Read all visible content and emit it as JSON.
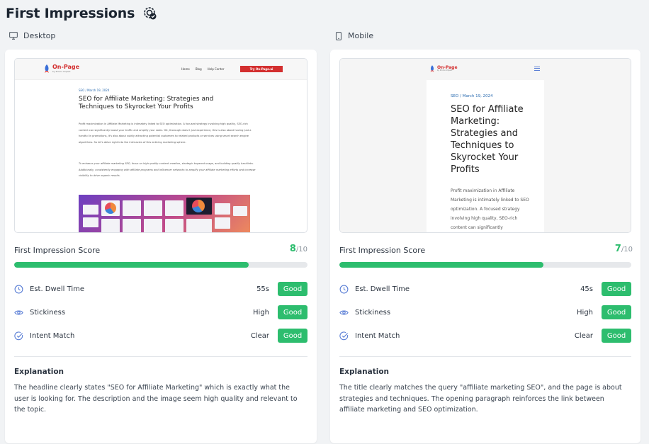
{
  "header": {
    "title": "First Impressions",
    "icon": "target-check-icon"
  },
  "columns": {
    "desktop": {
      "label": "Desktop",
      "preview": {
        "logo_main": "On-Page",
        "logo_sub": "by Promo Impact",
        "menu": [
          "Home",
          "Blog",
          "Help Center"
        ],
        "cta": "Try On-Page.ai",
        "meta": "SEO / March 19, 2024",
        "headline": "SEO for Affiliate Marketing: Strategies and Techniques to Skyrocket Your Profits",
        "para1": "Profit maximization in Affiliate Marketing is intimately linked to SEO optimization. A focused strategy involving high quality, SEO-rich content can significantly boost your traffic and amplify your sales. Yet, thorough does it just experience, this is also about having just a handful in promotions, it's also about subtly attracting potential customers to related products or services using smart search engine algorithms. So let's delve right into the intricacies of this enticing marketing sphere.",
        "para2": "To enhance your affiliate marketing SEO, focus on high-quality content creation, strategic keyword usage, and building quality backlinks. Additionally, consistently engaging with affiliate programs and influencer networks to amplify your affiliate marketing efforts and increase visibility to drive organic results."
      },
      "score": {
        "label": "First Impression Score",
        "value": "8",
        "out_of": "/10",
        "fraction": 0.8
      },
      "metrics": [
        {
          "name": "Est. Dwell Time",
          "value": "55s",
          "badge": "Good"
        },
        {
          "name": "Stickiness",
          "value": "High",
          "badge": "Good"
        },
        {
          "name": "Intent Match",
          "value": "Clear",
          "badge": "Good"
        }
      ],
      "explanation": {
        "title": "Explanation",
        "text": "The headline clearly states \"SEO for Affiliate Marketing\" which is exactly what the user is looking for. The description and the image seem high quality and relevant to the topic."
      }
    },
    "mobile": {
      "label": "Mobile",
      "preview": {
        "logo_main": "On-Page",
        "logo_sub": "by Promo Impact",
        "meta": "SEO / March 19, 2024",
        "headline": "SEO for Affiliate Marketing: Strategies and Techniques to Skyrocket Your Profits",
        "para": "Profit maximization in Affiliate Marketing is intimately linked to SEO optimization. A focused strategy involving high quality, SEO-rich content can significantly"
      },
      "score": {
        "label": "First Impression Score",
        "value": "7",
        "out_of": "/10",
        "fraction": 0.7
      },
      "metrics": [
        {
          "name": "Est. Dwell Time",
          "value": "45s",
          "badge": "Good"
        },
        {
          "name": "Stickiness",
          "value": "High",
          "badge": "Good"
        },
        {
          "name": "Intent Match",
          "value": "Clear",
          "badge": "Good"
        }
      ],
      "explanation": {
        "title": "Explanation",
        "text": "The title clearly matches the query \"affiliate marketing SEO\", and the page is about strategies and techniques. The opening paragraph reinforces the link between affiliate marketing and SEO optimization."
      }
    }
  },
  "colors": {
    "accent_green": "#2dbd6e",
    "brand_red": "#d32f2f",
    "link_blue": "#2b6cb0"
  }
}
